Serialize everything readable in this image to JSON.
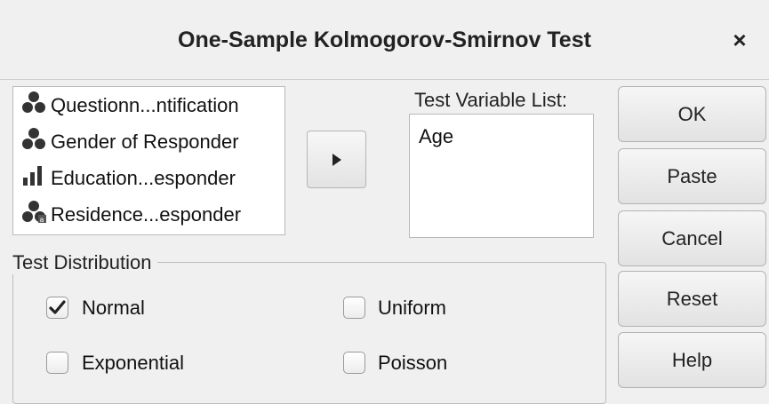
{
  "dialog": {
    "title": "One-Sample Kolmogorov-Smirnov Test",
    "close_label": "×"
  },
  "source_variables": [
    {
      "label": "Questionn...ntification",
      "icon": "nominal-icon"
    },
    {
      "label": "Gender of Responder",
      "icon": "nominal-icon"
    },
    {
      "label": "Education...esponder",
      "icon": "ordinal-icon"
    },
    {
      "label": "Residence...esponder",
      "icon": "nominal-icon"
    }
  ],
  "test_variables": {
    "label": "Test Variable List:",
    "items": [
      "Age"
    ]
  },
  "distribution": {
    "legend": "Test Distribution",
    "normal": {
      "label": "Normal",
      "checked": true
    },
    "uniform": {
      "label": "Uniform",
      "checked": false
    },
    "exponential": {
      "label": "Exponential",
      "checked": false
    },
    "poisson": {
      "label": "Poisson",
      "checked": false
    }
  },
  "buttons": {
    "ok": "OK",
    "paste": "Paste",
    "cancel": "Cancel",
    "reset": "Reset",
    "help": "Help"
  },
  "colors": {
    "background": "#f0f0f0",
    "icon": "#333333"
  }
}
